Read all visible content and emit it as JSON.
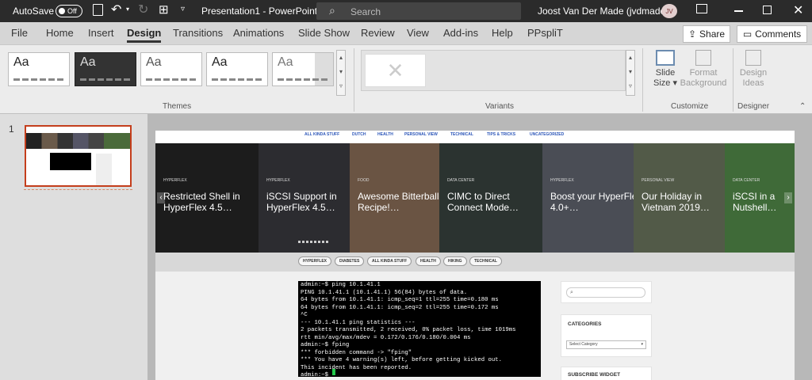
{
  "titlebar": {
    "autosave_label": "AutoSave",
    "autosave_state": "Off",
    "document_title": "Presentation1  -  PowerPoint",
    "search_placeholder": "Search",
    "user_name": "Joost Van Der Made (jvdmade)",
    "user_initials": "JV"
  },
  "ribbon_tabs": [
    "File",
    "Home",
    "Insert",
    "Design",
    "Transitions",
    "Animations",
    "Slide Show",
    "Review",
    "View",
    "Add-ins",
    "Help",
    "PPspliT"
  ],
  "active_tab": "Design",
  "header_buttons": {
    "share": "Share",
    "comments": "Comments"
  },
  "ribbon": {
    "theme_sample": "Aa",
    "themes_group": "Themes",
    "variants_group": "Variants",
    "slide_size_line1": "Slide",
    "slide_size_line2": "Size",
    "format_bg_line1": "Format",
    "format_bg_line2": "Background",
    "customize_group": "Customize",
    "design_ideas_line1": "Design",
    "design_ideas_line2": "Ideas",
    "designer_group": "Designer"
  },
  "slides_pane": {
    "slide_number": "1"
  },
  "slide": {
    "nav_items": [
      "ALL KINDA STUFF",
      "DUTCH",
      "HEALTH",
      "PERSONAL VIEW",
      "TECHNICAL",
      "TIPS & TRICKS",
      "UNCATEGORIZED"
    ],
    "carousel": [
      {
        "category": "HYPERFLEX",
        "title": "Restricted Shell in HyperFlex 4.5…"
      },
      {
        "category": "HYPERFLEX",
        "title": "iSCSI Support in HyperFlex 4.5…"
      },
      {
        "category": "FOOD",
        "title": "Awesome Bitterballen Recipe!…"
      },
      {
        "category": "DATA CENTER",
        "title": "CIMC to Direct Connect Mode…"
      },
      {
        "category": "HYPERFLEX",
        "title": "Boost your HyperFlex 4.0+…"
      },
      {
        "category": "PERSONAL VIEW",
        "title": "Our Holiday in Vietnam 2019…"
      },
      {
        "category": "DATA CENTER",
        "title": "iSCSI in a Nutshell…"
      }
    ],
    "carousel_prev": "‹",
    "carousel_next": "›",
    "tags": [
      "HYPERFLEX",
      "DIABETES",
      "ALL KINDA STUFF",
      "HEALTH",
      "HIKING",
      "TECHNICAL"
    ],
    "terminal_text": "admin:~$ ping 10.1.41.1\nPING 10.1.41.1 (10.1.41.1) 56(84) bytes of data.\n64 bytes from 10.1.41.1: icmp_seq=1 ttl=255 time=0.180 ms\n64 bytes from 10.1.41.1: icmp_seq=2 ttl=255 time=0.172 ms\n^C\n--- 10.1.41.1 ping statistics ---\n2 packets transmitted, 2 received, 0% packet loss, time 1019ms\nrtt min/avg/max/mdev = 0.172/0.176/0.180/0.004 ms\nadmin:~$ fping\n*** forbidden command -> \"fping\"\n*** You have 4 warning(s) left, before getting kicked out.\nThis incident has been reported.\nadmin:~$ ",
    "categories_title": "CATEGORIES",
    "category_select": "Select Category",
    "subscribe_title": "SUBSCRIBE WIDGET"
  }
}
